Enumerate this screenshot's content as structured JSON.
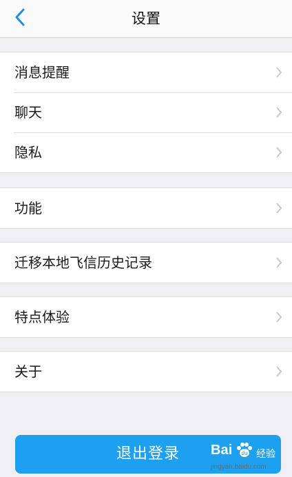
{
  "nav": {
    "title": "设置",
    "back_icon": "chevron-left-icon"
  },
  "groups": [
    {
      "items": [
        {
          "label": "消息提醒"
        },
        {
          "label": "聊天"
        },
        {
          "label": "隐私"
        }
      ]
    },
    {
      "items": [
        {
          "label": "功能"
        }
      ]
    },
    {
      "items": [
        {
          "label": "迁移本地飞信历史记录"
        }
      ]
    },
    {
      "items": [
        {
          "label": "特点体验"
        }
      ]
    },
    {
      "items": [
        {
          "label": "关于"
        }
      ]
    }
  ],
  "logout": {
    "label": "退出登录"
  },
  "watermark": {
    "brand": "Bai",
    "brand_suffix": "经验",
    "url": "jingyan.baidu.com"
  },
  "colors": {
    "accent": "#1ea0f0",
    "background": "#efeff4",
    "chevron": "#c7c7cc"
  }
}
